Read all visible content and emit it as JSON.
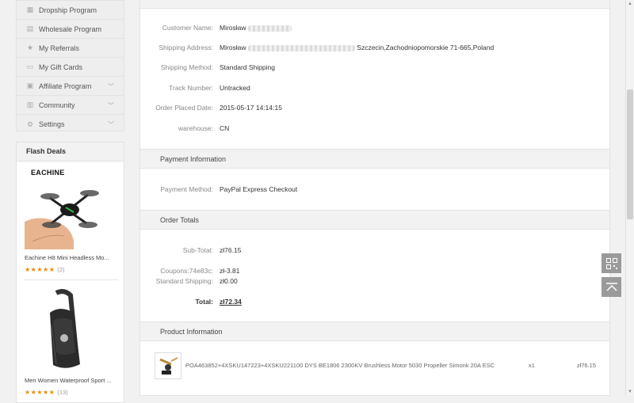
{
  "sidebar": {
    "items": [
      {
        "label": "Dropship Program",
        "icon": "dropship-icon",
        "chevron": false
      },
      {
        "label": "Wholesale Program",
        "icon": "wholesale-icon",
        "chevron": false
      },
      {
        "label": "My Referrals",
        "icon": "star-icon",
        "chevron": false
      },
      {
        "label": "My Gift Cards",
        "icon": "gift-card-icon",
        "chevron": false
      },
      {
        "label": "Affiliate Program",
        "icon": "affiliate-icon",
        "chevron": true
      },
      {
        "label": "Community",
        "icon": "community-icon",
        "chevron": true
      },
      {
        "label": "Settings",
        "icon": "gear-icon",
        "chevron": true
      }
    ]
  },
  "flash_deals": {
    "title": "Flash Deals",
    "products": [
      {
        "name": "Eachine H8 Mini Headless Mo...",
        "stars": "★★★★★",
        "count": "(2)",
        "brand": "EACHINE"
      },
      {
        "name": "Men Women Waterproof Sport ...",
        "stars": "★★★★★",
        "count": "(13)"
      }
    ]
  },
  "order": {
    "customer_name_label": "Customer Name:",
    "customer_name": "Mirosław",
    "shipping_address_label": "Shipping Address:",
    "shipping_address_prefix": "Mirosław",
    "shipping_address_suffix": "Szczecin,Zachodniopomorskie 71-665,Poland",
    "shipping_method_label": "Shipping Method:",
    "shipping_method": "Standard Shipping",
    "track_number_label": "Track Number:",
    "track_number": "Untracked",
    "order_placed_label": "Order Placed Date:",
    "order_placed": "2015-05-17 14:14:15",
    "warehouse_label": "warehouse:",
    "warehouse": "CN"
  },
  "payment": {
    "section_title": "Payment Information",
    "method_label": "Payment Method:",
    "method": "PayPal Express Checkout"
  },
  "totals": {
    "section_title": "Order Totals",
    "subtotal_label": "Sub-Total:",
    "subtotal": "zł76.15",
    "coupons_label": "Coupons:74e83c:",
    "coupons": "zł-3.81",
    "shipping_label": "Standard Shipping:",
    "shipping": "zł0.00",
    "total_label": "Total:",
    "total": "zł72.34"
  },
  "product_info": {
    "section_title": "Product Information",
    "sku_line": "POA463852+4XSKU147223+4XSKU221100 DYS BE1806 2300KV Brushless Motor 5030 Propeller Simonk 20A ESC",
    "qty": "x1",
    "price": "zł76.15"
  },
  "colors": {
    "accent_star": "#f08a00",
    "section_bg": "#f2f2f2"
  }
}
